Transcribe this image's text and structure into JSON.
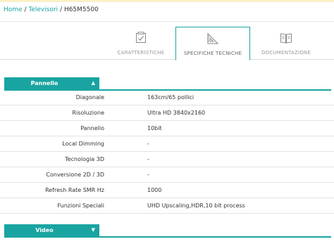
{
  "breadcrumb": {
    "home": "Home",
    "sep1": "/",
    "category": "Televisori",
    "sep2": "/",
    "current": "H65M5500"
  },
  "tabs": [
    {
      "label": "CARATTERISTICHE",
      "icon": "checklist-icon",
      "active": false
    },
    {
      "label": "SPECIFICHE TECNICHE",
      "icon": "set-square-icon",
      "active": true
    },
    {
      "label": "DOCUMENTAZIONE",
      "icon": "document-icon",
      "active": false
    }
  ],
  "sections": {
    "pannello": {
      "title": "Pannello",
      "arrow": "▲",
      "rows": [
        {
          "key": "Diagonale",
          "value": "163cm/65 pollici"
        },
        {
          "key": "Risoluzione",
          "value": "Ultra HD 3840x2160"
        },
        {
          "key": "Pannello",
          "value": "10bit"
        },
        {
          "key": "Local Dimming",
          "value": "-"
        },
        {
          "key": "Tecnologia 3D",
          "value": "-"
        },
        {
          "key": "Conversione 2D / 3D",
          "value": "-"
        },
        {
          "key": "Refresh Rate SMR Hz",
          "value": "1000"
        },
        {
          "key": "Funzioni Speciali",
          "value": "UHD Upscaling,HDR,10 bit process"
        }
      ]
    },
    "video": {
      "title": "Video",
      "arrow": "▼"
    }
  },
  "colors": {
    "accent": "#1aa4a1",
    "topstrip": "#fbf1c8"
  }
}
